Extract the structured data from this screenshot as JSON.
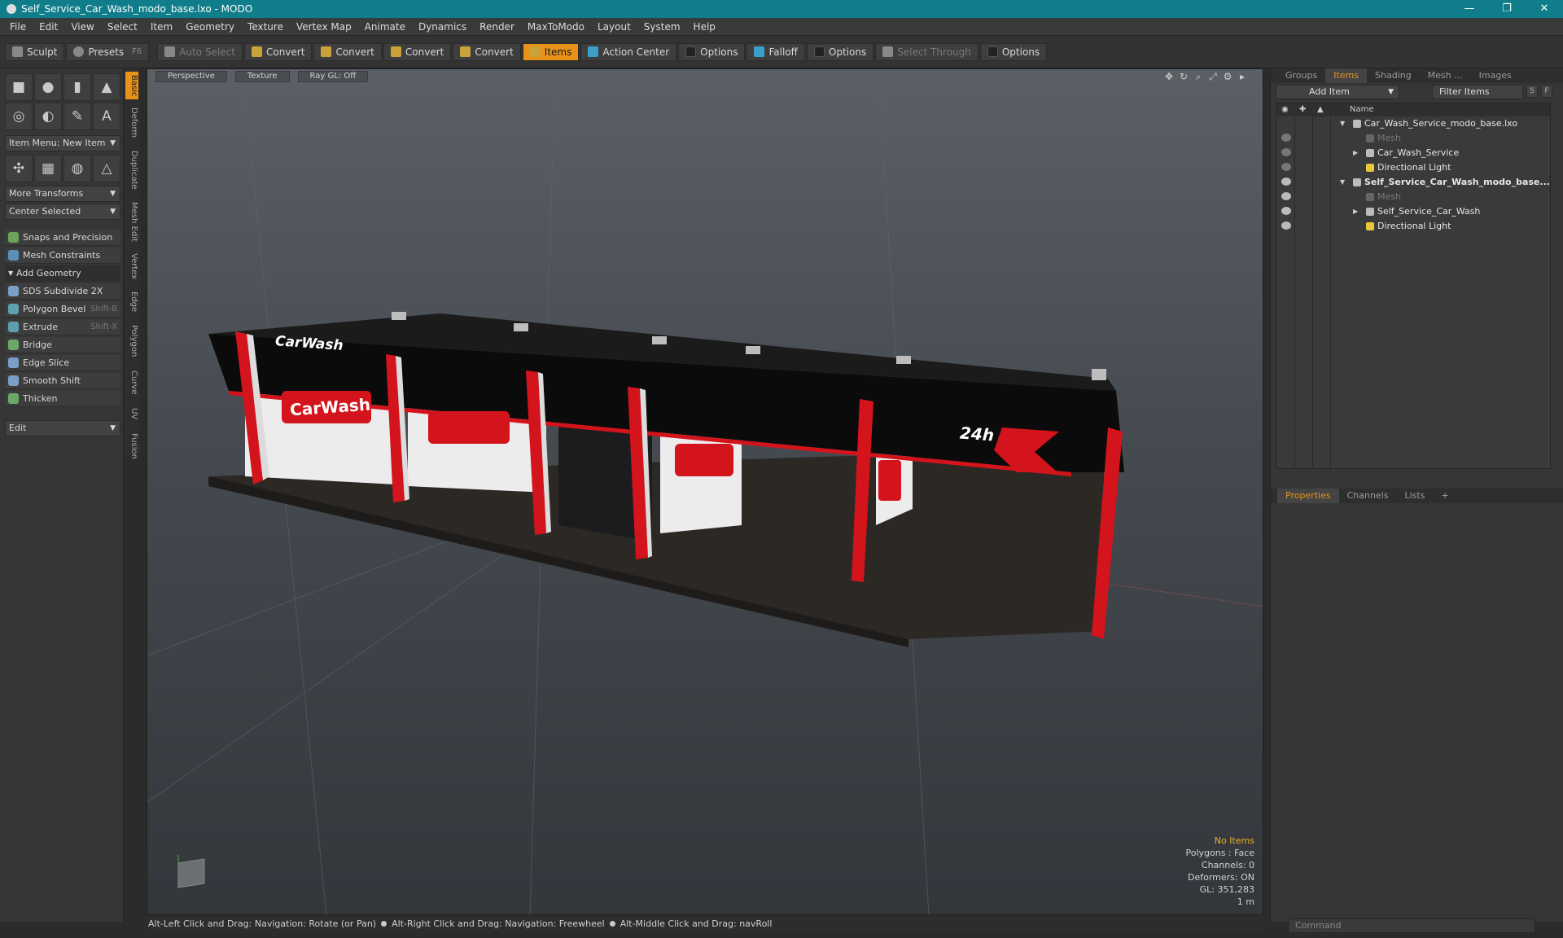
{
  "window": {
    "title": "Self_Service_Car_Wash_modo_base.lxo - MODO",
    "minimize": "—",
    "maximize": "❐",
    "close": "✕"
  },
  "menu": [
    "File",
    "Edit",
    "View",
    "Select",
    "Item",
    "Geometry",
    "Texture",
    "Vertex Map",
    "Animate",
    "Dynamics",
    "Render",
    "MaxToModo",
    "Layout",
    "System",
    "Help"
  ],
  "toolbar": {
    "sculpt": "Sculpt",
    "presets": "Presets",
    "presets_key": "F6",
    "auto_select": "Auto Select",
    "convert1": "Convert",
    "convert2": "Convert",
    "convert3": "Convert",
    "convert4": "Convert",
    "items": "Items",
    "action_center": "Action Center",
    "options1": "Options",
    "falloff": "Falloff",
    "options2": "Options",
    "select_through": "Select Through",
    "options3": "Options"
  },
  "left": {
    "item_menu": "Item Menu: New Item",
    "more_transforms": "More Transforms",
    "center_selected": "Center Selected",
    "snaps": "Snaps and Precision",
    "mesh_constraints": "Mesh Constraints",
    "add_geometry": "Add Geometry",
    "tools": [
      {
        "label": "SDS Subdivide 2X",
        "shortcut": ""
      },
      {
        "label": "Polygon Bevel",
        "shortcut": "Shift-B"
      },
      {
        "label": "Extrude",
        "shortcut": "Shift-X"
      },
      {
        "label": "Bridge",
        "shortcut": ""
      },
      {
        "label": "Edge Slice",
        "shortcut": ""
      },
      {
        "label": "Smooth Shift",
        "shortcut": ""
      },
      {
        "label": "Thicken",
        "shortcut": ""
      }
    ],
    "edit": "Edit"
  },
  "vtabs": [
    "Basic",
    "Deform",
    "Duplicate",
    "Mesh Edit",
    "Vertex",
    "Edge",
    "Polygon",
    "Curve",
    "UV",
    "Fusion"
  ],
  "viewport": {
    "tabs": [
      "Perspective",
      "Texture",
      "Ray GL: Off"
    ],
    "stats": {
      "no_items": "No Items",
      "polygons": "Polygons : Face",
      "channels": "Channels: 0",
      "deformers": "Deformers: ON",
      "gl": "GL: 351,283",
      "scale": "1 m"
    },
    "signs": {
      "carwash_top": "CarWash",
      "carwash_wall": "CarWash",
      "hours": "24h"
    }
  },
  "items_panel": {
    "tabs": [
      "Groups",
      "Items",
      "Shading",
      "Mesh ...",
      "Images"
    ],
    "add_item": "Add Item",
    "filter_items": "Filter Items",
    "s_btn": "S",
    "f_btn": "F",
    "col_name": "Name",
    "rows": [
      {
        "label": "Car_Wash_Service_modo_base.lxo",
        "level": 0,
        "dim": false,
        "bold": false
      },
      {
        "label": "Mesh",
        "level": 1,
        "dim": true,
        "bold": false
      },
      {
        "label": "Car_Wash_Service",
        "level": 1,
        "dim": false,
        "bold": false
      },
      {
        "label": "Directional Light",
        "level": 1,
        "dim": false,
        "bold": false
      },
      {
        "label": "Self_Service_Car_Wash_modo_base...",
        "level": 0,
        "dim": false,
        "bold": true
      },
      {
        "label": "Mesh",
        "level": 1,
        "dim": true,
        "bold": false
      },
      {
        "label": "Self_Service_Car_Wash",
        "level": 1,
        "dim": false,
        "bold": false
      },
      {
        "label": "Directional Light",
        "level": 1,
        "dim": false,
        "bold": false
      }
    ]
  },
  "properties_panel": {
    "tabs": [
      "Properties",
      "Channels",
      "Lists"
    ]
  },
  "status": {
    "hint1": "Alt-Left Click and Drag: Navigation: Rotate (or Pan)",
    "hint2": "Alt-Right Click and Drag: Navigation: Freewheel",
    "hint3": "Alt-Middle Click and Drag: navRoll"
  },
  "command": {
    "placeholder": "Command"
  },
  "colors": {
    "accent": "#e8921a",
    "titlebar": "#0f7d8a",
    "brand_red": "#d4141c"
  }
}
